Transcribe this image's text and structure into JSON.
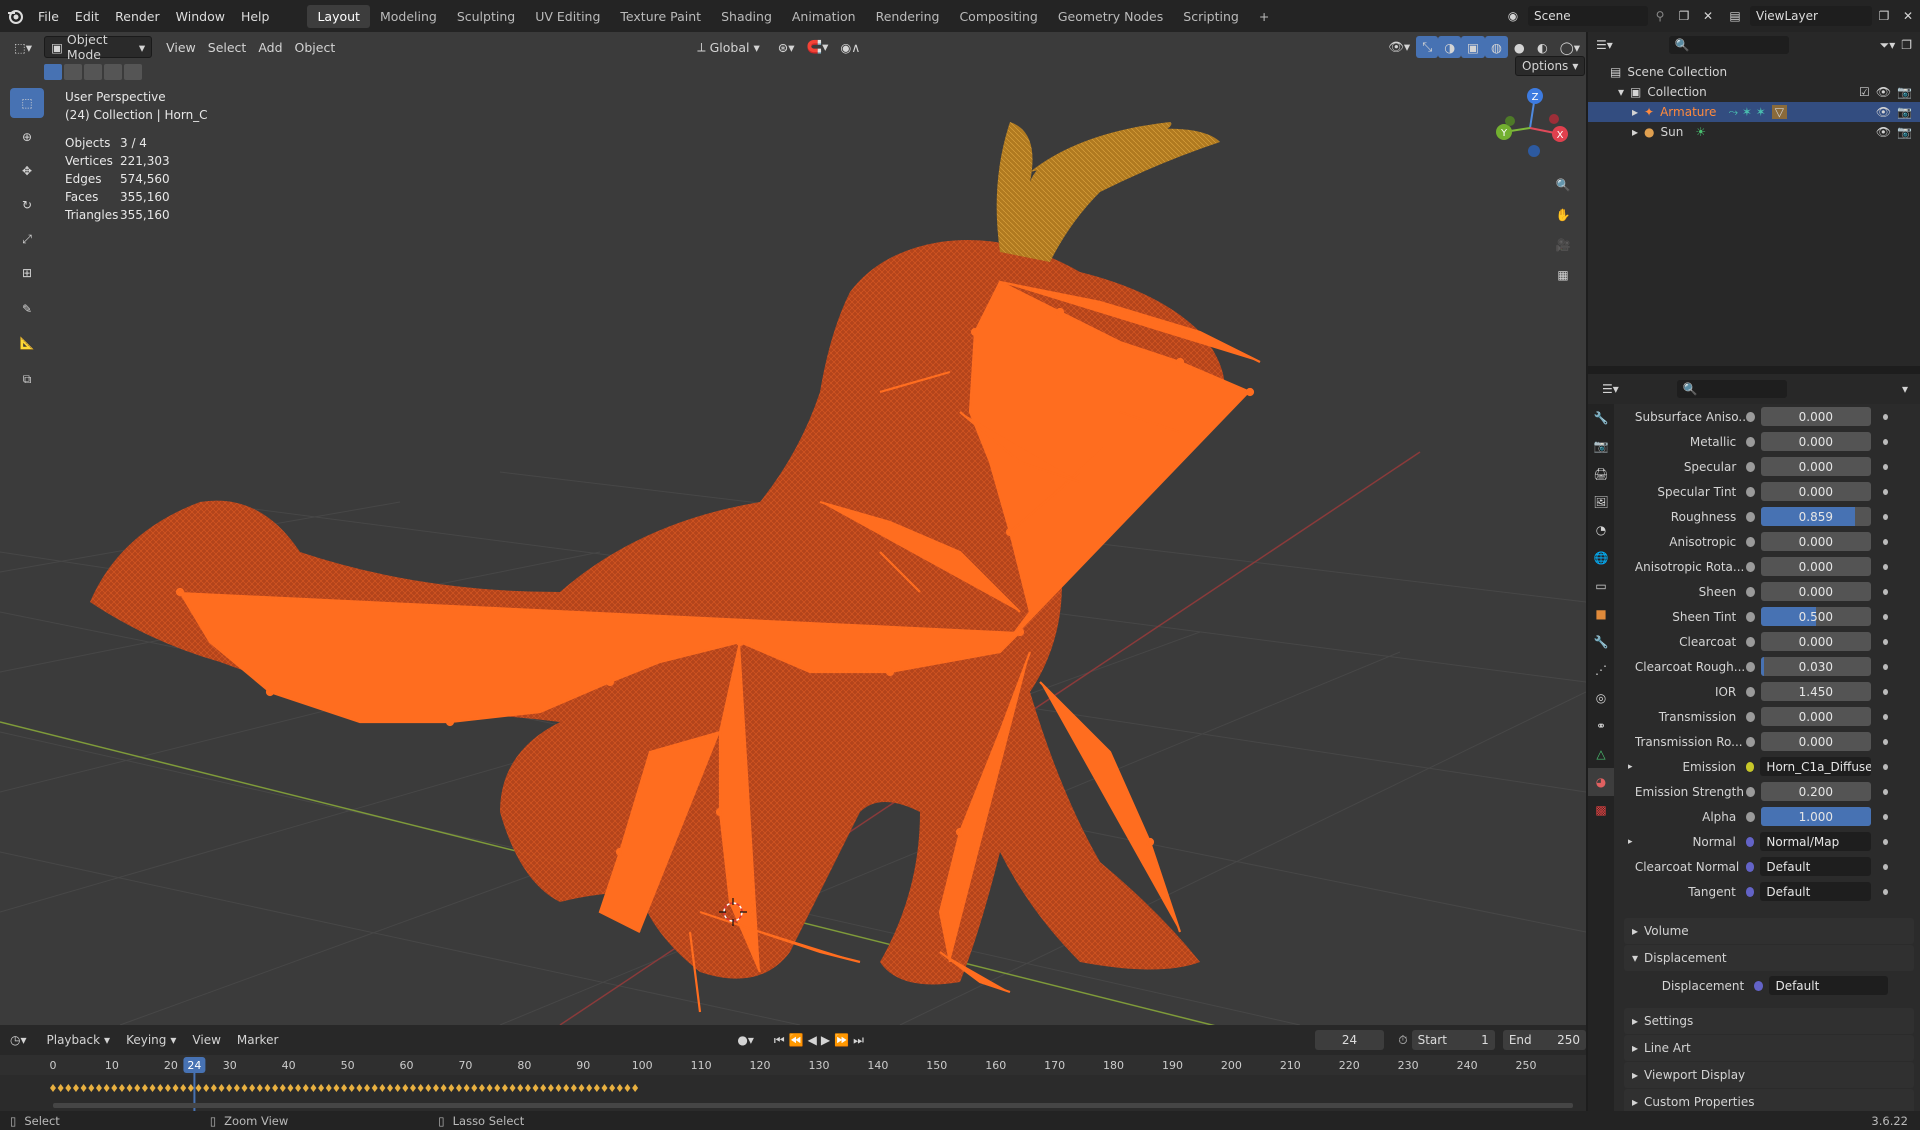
{
  "menu": [
    "File",
    "Edit",
    "Render",
    "Window",
    "Help"
  ],
  "workspaces": [
    "Layout",
    "Modeling",
    "Sculpting",
    "UV Editing",
    "Texture Paint",
    "Shading",
    "Animation",
    "Rendering",
    "Compositing",
    "Geometry Nodes",
    "Scripting",
    "+"
  ],
  "scene": {
    "name": "Scene",
    "view_layer": "ViewLayer"
  },
  "viewport": {
    "mode": "Object Mode",
    "menus": [
      "View",
      "Select",
      "Add",
      "Object"
    ],
    "orientation": "Global",
    "options": "Options",
    "perspective": "User Perspective",
    "context": "(24) Collection | Horn_C",
    "stats": [
      {
        "k": "Objects",
        "v": "3 / 4"
      },
      {
        "k": "Vertices",
        "v": "221,303"
      },
      {
        "k": "Edges",
        "v": "574,560"
      },
      {
        "k": "Faces",
        "v": "355,160"
      },
      {
        "k": "Triangles",
        "v": "355,160"
      }
    ],
    "gizmo": {
      "z": "Z",
      "y": "Y",
      "x": "X"
    }
  },
  "outliner": {
    "scene_collection": "Scene Collection",
    "collection": "Collection",
    "items": [
      "Armature",
      "Sun"
    ]
  },
  "properties": {
    "rows": [
      {
        "label": "Subsurface Aniso...",
        "value": "0.000",
        "fill": 0
      },
      {
        "label": "Metallic",
        "value": "0.000",
        "fill": 0
      },
      {
        "label": "Specular",
        "value": "0.000",
        "fill": 0
      },
      {
        "label": "Specular Tint",
        "value": "0.000",
        "fill": 0
      },
      {
        "label": "Roughness",
        "value": "0.859",
        "fill": 0.859
      },
      {
        "label": "Anisotropic",
        "value": "0.000",
        "fill": 0
      },
      {
        "label": "Anisotropic Rota...",
        "value": "0.000",
        "fill": 0
      },
      {
        "label": "Sheen",
        "value": "0.000",
        "fill": 0
      },
      {
        "label": "Sheen Tint",
        "value": "0.500",
        "fill": 0.5
      },
      {
        "label": "Clearcoat",
        "value": "0.000",
        "fill": 0
      },
      {
        "label": "Clearcoat Rough...",
        "value": "0.030",
        "fill": 0.03
      },
      {
        "label": "IOR",
        "value": "1.450",
        "fill": 0
      },
      {
        "label": "Transmission",
        "value": "0.000",
        "fill": 0
      },
      {
        "label": "Transmission Ro...",
        "value": "0.000",
        "fill": 0
      },
      {
        "label": "Emission",
        "value": "Horn_C1a_Diffuse",
        "link": true
      },
      {
        "label": "Emission Strength",
        "value": "0.200",
        "fill": 0
      },
      {
        "label": "Alpha",
        "value": "1.000",
        "fill": 1
      },
      {
        "label": "Normal",
        "value": "Normal/Map",
        "link": true
      },
      {
        "label": "Clearcoat Normal",
        "value": "Default",
        "link": true
      },
      {
        "label": "Tangent",
        "value": "Default",
        "link": true
      }
    ],
    "panels": [
      "Volume",
      "Displacement",
      "Settings",
      "Line Art",
      "Viewport Display",
      "Custom Properties"
    ],
    "displacement": {
      "label": "Displacement",
      "value": "Default"
    }
  },
  "timeline": {
    "menus": [
      "Playback",
      "Keying",
      "View",
      "Marker"
    ],
    "current_frame": "24",
    "start_label": "Start",
    "start": "1",
    "end_label": "End",
    "end": "250",
    "ticks": [
      "0",
      "10",
      "20",
      "24",
      "30",
      "40",
      "50",
      "60",
      "70",
      "80",
      "90",
      "100",
      "110",
      "120",
      "130",
      "140",
      "150",
      "160",
      "170",
      "180",
      "190",
      "200",
      "210",
      "220",
      "230",
      "240",
      "250"
    ]
  },
  "status": {
    "select": "Select",
    "zoom": "Zoom View",
    "lasso": "Lasso Select",
    "version": "3.6.22"
  },
  "colors": {
    "accent": "#4772b3",
    "selected": "#ff6b1a",
    "mesh": "#c0461c"
  }
}
